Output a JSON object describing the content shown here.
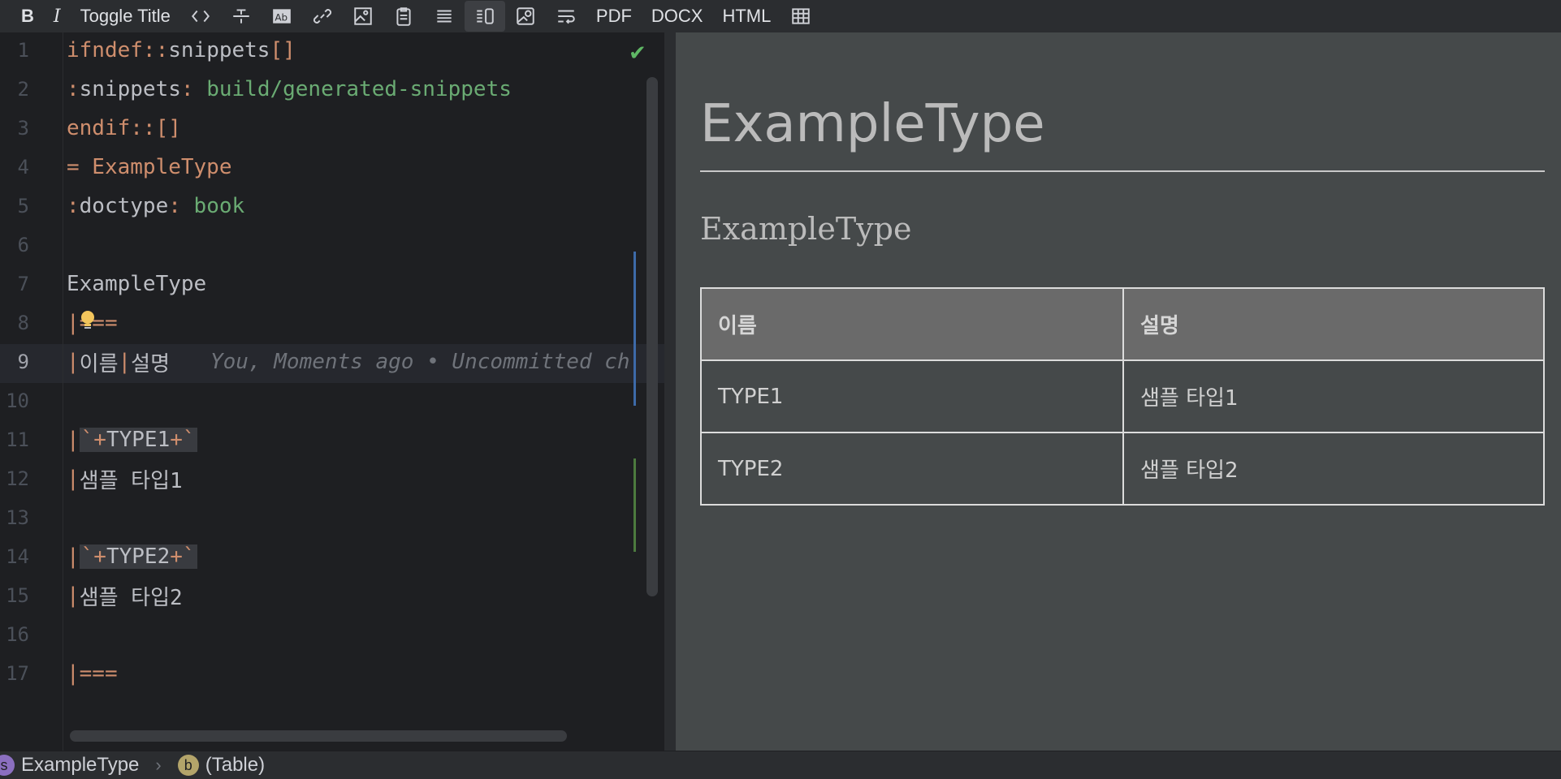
{
  "toolbar": {
    "bold": "B",
    "italic": "I",
    "toggle_title": "Toggle Title",
    "pdf": "PDF",
    "docx": "DOCX",
    "html": "HTML"
  },
  "editor": {
    "line_numbers": [
      "1",
      "2",
      "3",
      "4",
      "5",
      "6",
      "7",
      "8",
      "9",
      "10",
      "11",
      "12",
      "13",
      "14",
      "15",
      "16",
      "17"
    ],
    "current_line": "9",
    "lines": {
      "l1_a": "ifndef::",
      "l1_b": "snippets",
      "l1_c": "[]",
      "l2_a": ":",
      "l2_b": "snippets",
      "l2_c": ": ",
      "l2_d": "build/generated-snippets",
      "l3": "endif::[]",
      "l4": "= ExampleType",
      "l5_a": ":",
      "l5_b": "doctype",
      "l5_c": ": ",
      "l5_d": "book",
      "l7": "ExampleType",
      "l8": "|===",
      "l9_p1": "|",
      "l9_a": "이름",
      "l9_p2": "|",
      "l9_b": "설명",
      "l9_ghost": "You, Moments ago • Uncommitted ch",
      "l11_p": "|",
      "l11_m1": "`+",
      "l11_v": "TYPE1",
      "l11_m2": "+`",
      "l12_p": "|",
      "l12_v": "샘플 타입1",
      "l14_p": "|",
      "l14_m1": "`+",
      "l14_v": "TYPE2",
      "l14_m2": "+`",
      "l15_p": "|",
      "l15_v": "샘플 타입2",
      "l17": "|==="
    }
  },
  "preview": {
    "title": "ExampleType",
    "subtitle": "ExampleType",
    "table": {
      "headers": [
        "이름",
        "설명"
      ],
      "rows": [
        [
          "TYPE1",
          "샘플 타입1"
        ],
        [
          "TYPE2",
          "샘플 타입2"
        ]
      ]
    }
  },
  "status": {
    "badge1": "s",
    "crumb1": "ExampleType",
    "sep": "›",
    "badge2": "b",
    "crumb2": "(Table)"
  },
  "colors": {
    "keyword": "#cf8e6d",
    "string": "#6aab73",
    "badge1": "#8b6fc0",
    "badge2": "#b3a46a"
  }
}
